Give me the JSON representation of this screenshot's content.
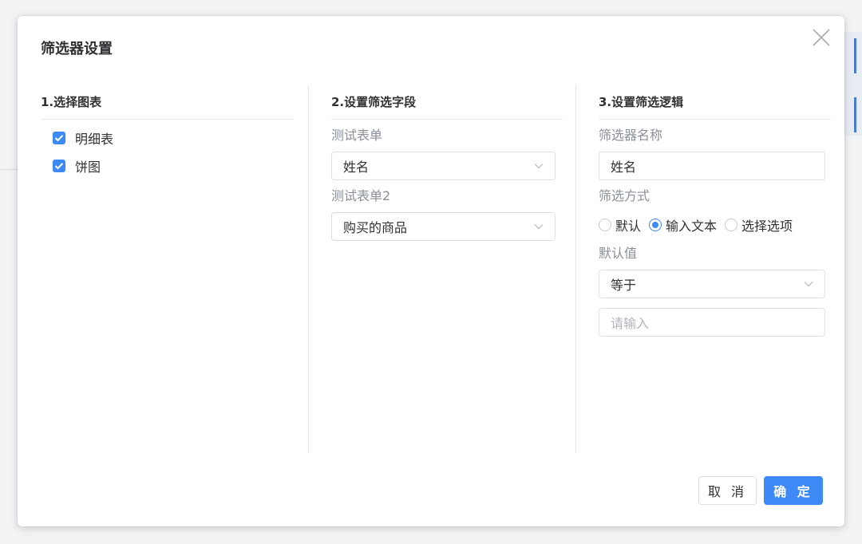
{
  "dialog": {
    "title": "筛选器设置"
  },
  "columns": {
    "chart_select": {
      "header": "1.选择图表",
      "options": [
        {
          "label": "明细表",
          "checked": true
        },
        {
          "label": "饼图",
          "checked": true
        }
      ]
    },
    "filter_fields": {
      "header": "2.设置筛选字段",
      "fields": [
        {
          "form_label": "测试表单",
          "selected": "姓名"
        },
        {
          "form_label": "测试表单2",
          "selected": "购买的商品"
        }
      ]
    },
    "filter_logic": {
      "header": "3.设置筛选逻辑",
      "name_label": "筛选器名称",
      "name_value": "姓名",
      "mode_label": "筛选方式",
      "modes": [
        {
          "label": "默认",
          "selected": false
        },
        {
          "label": "输入文本",
          "selected": true
        },
        {
          "label": "选择选项",
          "selected": false
        }
      ],
      "default_label": "默认值",
      "operator": "等于",
      "value_placeholder": "请输入"
    }
  },
  "footer": {
    "cancel_label": "取 消",
    "ok_label": "确 定"
  },
  "colors": {
    "accent": "#3d8af7",
    "border": "#dcdfe6",
    "muted_text": "#8a8f99"
  }
}
